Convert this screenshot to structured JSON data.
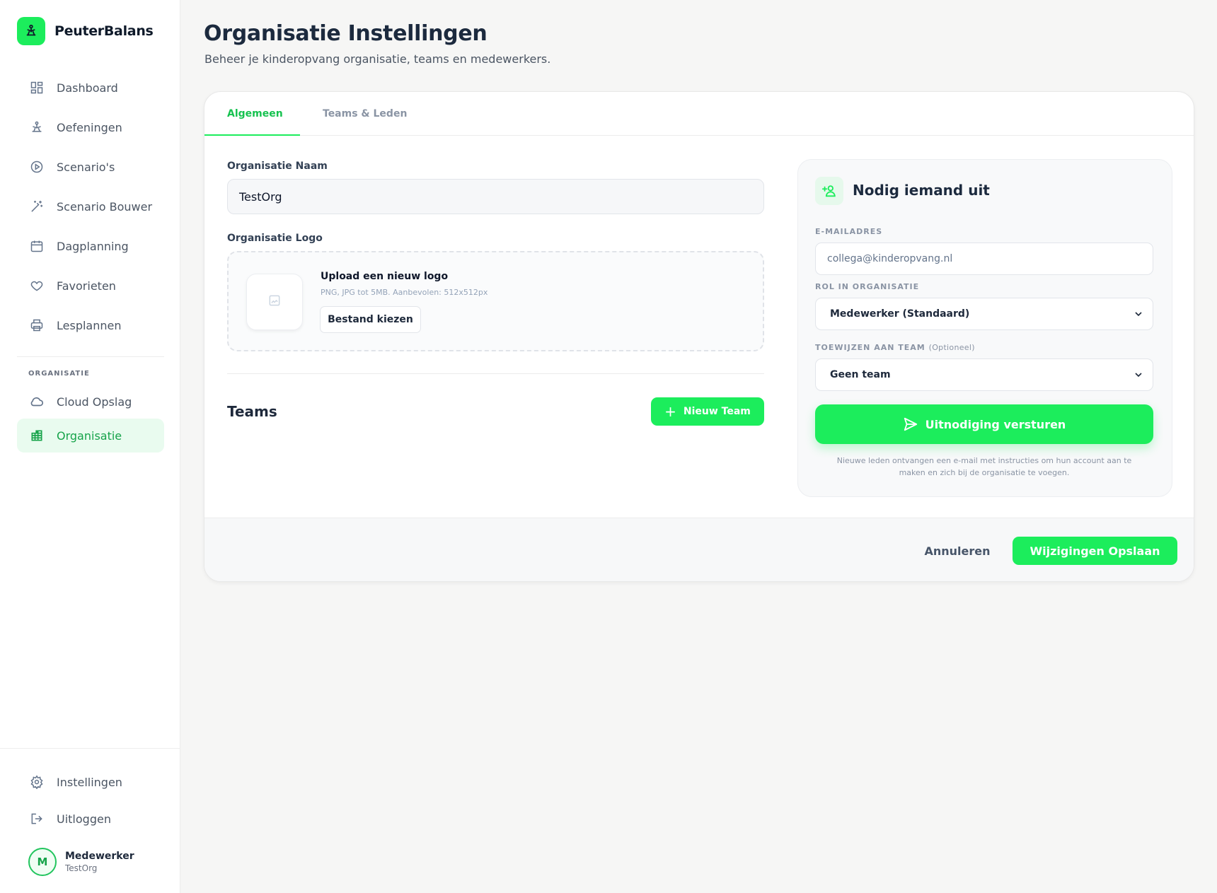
{
  "brand": {
    "name": "PeuterBalans"
  },
  "sidebar": {
    "items": [
      {
        "label": "Dashboard",
        "icon": "dashboard-icon"
      },
      {
        "label": "Oefeningen",
        "icon": "yoga-icon"
      },
      {
        "label": "Scenario's",
        "icon": "play-circle-icon"
      },
      {
        "label": "Scenario Bouwer",
        "icon": "magic-wand-icon"
      },
      {
        "label": "Dagplanning",
        "icon": "calendar-icon"
      },
      {
        "label": "Favorieten",
        "icon": "heart-icon"
      },
      {
        "label": "Lesplannen",
        "icon": "printer-icon"
      }
    ],
    "section_title": "ORGANISATIE",
    "org_items": [
      {
        "label": "Cloud Opslag",
        "icon": "cloud-icon"
      },
      {
        "label": "Organisatie",
        "icon": "building-icon",
        "active": true
      }
    ],
    "bottom_items": [
      {
        "label": "Instellingen",
        "icon": "gear-icon"
      },
      {
        "label": "Uitloggen",
        "icon": "logout-icon"
      }
    ],
    "user": {
      "initial": "M",
      "name": "Medewerker",
      "org": "TestOrg"
    }
  },
  "header": {
    "title": "Organisatie Instellingen",
    "subtitle": "Beheer je kinderopvang organisatie, teams en medewerkers."
  },
  "tabs": [
    {
      "label": "Algemeen",
      "active": true
    },
    {
      "label": "Teams & Leden",
      "active": false
    }
  ],
  "general": {
    "name_label": "Organisatie Naam",
    "name_value": "TestOrg",
    "logo_label": "Organisatie Logo",
    "upload_title": "Upload een nieuw logo",
    "upload_hint": "PNG, JPG tot 5MB. Aanbevolen: 512x512px",
    "file_button": "Bestand kiezen",
    "teams_title": "Teams",
    "new_team_button": "Nieuw Team"
  },
  "invite": {
    "title": "Nodig iemand uit",
    "email_label": "E-MAILADRES",
    "email_placeholder": "collega@kinderopvang.nl",
    "role_label": "ROL IN ORGANISATIE",
    "role_value": "Medewerker (Standaard)",
    "team_label": "TOEWIJZEN AAN TEAM",
    "team_optional": "(Optioneel)",
    "team_value": "Geen team",
    "send_button": "Uitnodiging versturen",
    "note": "Nieuwe leden ontvangen een e-mail met instructies om hun account aan te maken en zich bij de organisatie te voegen."
  },
  "footer": {
    "cancel": "Annuleren",
    "save": "Wijzigingen Opslaan"
  },
  "colors": {
    "accent": "#1ced5c",
    "accent_text": "#16c24f",
    "active_bg": "#e9fbef"
  }
}
